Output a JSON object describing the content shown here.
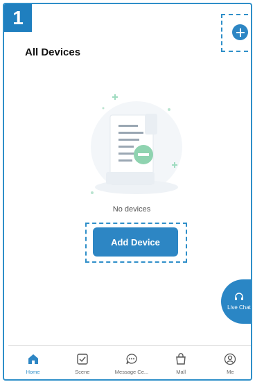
{
  "step_badge": "1",
  "header": {
    "title": "All Devices",
    "add_icon": "plus-circle-icon"
  },
  "empty_state": {
    "illustration": "empty-document-illustration",
    "message": "No devices",
    "add_button_label": "Add Device"
  },
  "live_chat": {
    "icon": "headset-icon",
    "label": "Live Chat"
  },
  "tabbar": {
    "items": [
      {
        "label": "Home",
        "icon": "home-icon",
        "active": true
      },
      {
        "label": "Scene",
        "icon": "checkbox-icon",
        "active": false
      },
      {
        "label": "Message Ce...",
        "icon": "chat-bubble-icon",
        "active": false
      },
      {
        "label": "Mall",
        "icon": "shopping-bag-icon",
        "active": false
      },
      {
        "label": "Me",
        "icon": "user-icon",
        "active": false
      }
    ]
  },
  "colors": {
    "accent": "#2d86c4",
    "highlight": "#2f8fc9",
    "illustration_green": "#8fd3b0"
  }
}
